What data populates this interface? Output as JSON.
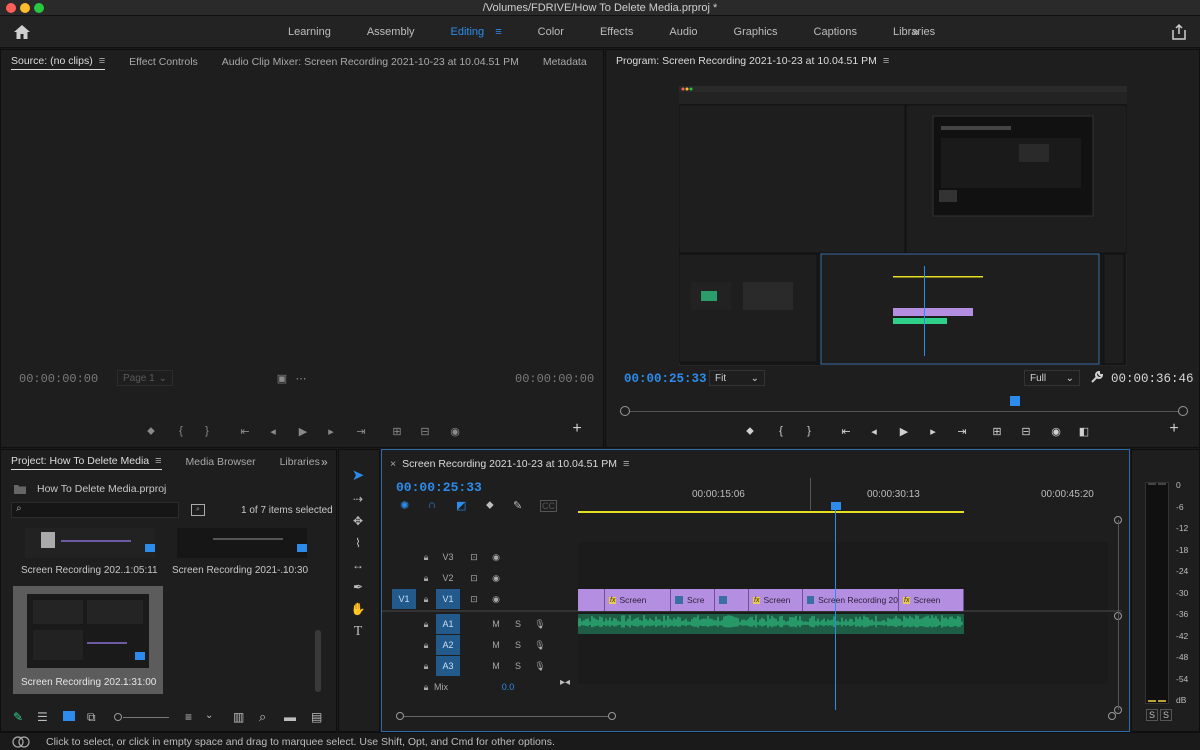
{
  "window": {
    "title": "/Volumes/FDRIVE/How To Delete Media.prproj *"
  },
  "colors": {
    "accent": "#2d8ceb",
    "clip": "#b48ee0",
    "audio": "#2fd18a",
    "track_target": "#235a8c",
    "work_area": "#e6e020"
  },
  "workspace": {
    "tabs": [
      "Learning",
      "Assembly",
      "Editing",
      "Color",
      "Effects",
      "Audio",
      "Graphics",
      "Captions",
      "Libraries"
    ],
    "active": "Editing",
    "more_icon": "»"
  },
  "source_panel": {
    "tabs": [
      "Source: (no clips)",
      "Effect Controls",
      "Audio Clip Mixer: Screen Recording 2021-10-23 at 10.04.51 PM",
      "Metadata"
    ],
    "timecode_in": "00:00:00:00",
    "timecode_out": "00:00:00:00",
    "page_select": "Page 1"
  },
  "program_panel": {
    "title": "Program: Screen Recording 2021-10-23 at 10.04.51 PM",
    "timecode": "00:00:25:33",
    "fit": "Fit",
    "quality": "Full",
    "duration": "00:00:36:46",
    "playhead_fraction": 0.7
  },
  "project_panel": {
    "tabs": [
      "Project: How To Delete Media",
      "Media Browser",
      "Libraries"
    ],
    "project_file": "How To Delete Media.prproj",
    "selection": "1 of 7 items selected",
    "items": [
      {
        "name": "Screen Recording 202...",
        "duration": "1:05:11"
      },
      {
        "name": "Screen Recording 2021-...",
        "duration": "10:30"
      },
      {
        "name": "Screen Recording 202...",
        "duration": "1:31:00"
      }
    ]
  },
  "timeline": {
    "title": "Screen Recording 2021-10-23 at 10.04.51 PM",
    "close_icon": "×",
    "timecode": "00:00:25:33",
    "ruler": [
      "00:00:15:06",
      "00:00:30:13",
      "00:00:45:20"
    ],
    "video_tracks": [
      "V3",
      "V2",
      "V1"
    ],
    "audio_tracks": [
      "A1",
      "A2",
      "A3"
    ],
    "source_patch": "V1",
    "mix_label": "Mix",
    "mix_value": "0.0",
    "track_buttons": {
      "mute": "M",
      "solo": "S"
    },
    "clips": [
      {
        "label": "Screen",
        "fx": "fx"
      },
      {
        "label": "Scre",
        "fx": ""
      },
      {
        "label": "",
        "fx": ""
      },
      {
        "label": "Screen",
        "fx": "fx"
      },
      {
        "label": "Screen Recording 20",
        "fx": ""
      },
      {
        "label": "Screen",
        "fx": "fx"
      }
    ],
    "fx_label": "fx"
  },
  "audio_meter": {
    "scale": [
      "0",
      "-6",
      "-12",
      "-18",
      "-24",
      "-30",
      "-36",
      "-42",
      "-48",
      "-54",
      "dB"
    ],
    "solo_buttons": [
      "S",
      "S"
    ]
  },
  "status": {
    "message": "Click to select, or click in empty space and drag to marquee select. Use Shift, Opt, and Cmd for other options."
  }
}
